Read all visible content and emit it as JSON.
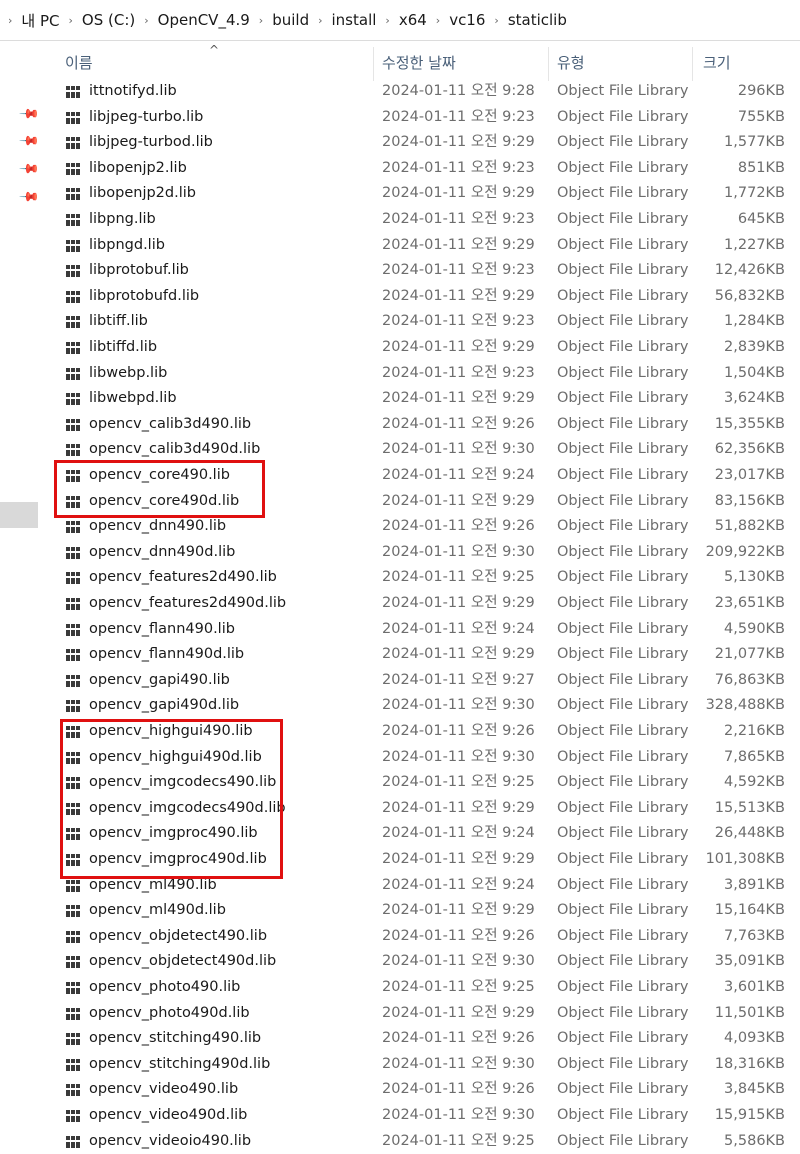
{
  "breadcrumb": [
    "내 PC",
    "OS (C:)",
    "OpenCV_4.9",
    "build",
    "install",
    "x64",
    "vc16",
    "staticlib"
  ],
  "columns": {
    "name": "이름",
    "date": "수정한 날짜",
    "type": "유형",
    "size": "크기"
  },
  "files": [
    {
      "name": "ittnotifyd.lib",
      "date": "2024-01-11 오전 9:28",
      "type": "Object File Library",
      "size": "296KB"
    },
    {
      "name": "libjpeg-turbo.lib",
      "date": "2024-01-11 오전 9:23",
      "type": "Object File Library",
      "size": "755KB"
    },
    {
      "name": "libjpeg-turbod.lib",
      "date": "2024-01-11 오전 9:29",
      "type": "Object File Library",
      "size": "1,577KB"
    },
    {
      "name": "libopenjp2.lib",
      "date": "2024-01-11 오전 9:23",
      "type": "Object File Library",
      "size": "851KB"
    },
    {
      "name": "libopenjp2d.lib",
      "date": "2024-01-11 오전 9:29",
      "type": "Object File Library",
      "size": "1,772KB"
    },
    {
      "name": "libpng.lib",
      "date": "2024-01-11 오전 9:23",
      "type": "Object File Library",
      "size": "645KB"
    },
    {
      "name": "libpngd.lib",
      "date": "2024-01-11 오전 9:29",
      "type": "Object File Library",
      "size": "1,227KB"
    },
    {
      "name": "libprotobuf.lib",
      "date": "2024-01-11 오전 9:23",
      "type": "Object File Library",
      "size": "12,426KB"
    },
    {
      "name": "libprotobufd.lib",
      "date": "2024-01-11 오전 9:29",
      "type": "Object File Library",
      "size": "56,832KB"
    },
    {
      "name": "libtiff.lib",
      "date": "2024-01-11 오전 9:23",
      "type": "Object File Library",
      "size": "1,284KB"
    },
    {
      "name": "libtiffd.lib",
      "date": "2024-01-11 오전 9:29",
      "type": "Object File Library",
      "size": "2,839KB"
    },
    {
      "name": "libwebp.lib",
      "date": "2024-01-11 오전 9:23",
      "type": "Object File Library",
      "size": "1,504KB"
    },
    {
      "name": "libwebpd.lib",
      "date": "2024-01-11 오전 9:29",
      "type": "Object File Library",
      "size": "3,624KB"
    },
    {
      "name": "opencv_calib3d490.lib",
      "date": "2024-01-11 오전 9:26",
      "type": "Object File Library",
      "size": "15,355KB"
    },
    {
      "name": "opencv_calib3d490d.lib",
      "date": "2024-01-11 오전 9:30",
      "type": "Object File Library",
      "size": "62,356KB"
    },
    {
      "name": "opencv_core490.lib",
      "date": "2024-01-11 오전 9:24",
      "type": "Object File Library",
      "size": "23,017KB"
    },
    {
      "name": "opencv_core490d.lib",
      "date": "2024-01-11 오전 9:29",
      "type": "Object File Library",
      "size": "83,156KB"
    },
    {
      "name": "opencv_dnn490.lib",
      "date": "2024-01-11 오전 9:26",
      "type": "Object File Library",
      "size": "51,882KB"
    },
    {
      "name": "opencv_dnn490d.lib",
      "date": "2024-01-11 오전 9:30",
      "type": "Object File Library",
      "size": "209,922KB"
    },
    {
      "name": "opencv_features2d490.lib",
      "date": "2024-01-11 오전 9:25",
      "type": "Object File Library",
      "size": "5,130KB"
    },
    {
      "name": "opencv_features2d490d.lib",
      "date": "2024-01-11 오전 9:29",
      "type": "Object File Library",
      "size": "23,651KB"
    },
    {
      "name": "opencv_flann490.lib",
      "date": "2024-01-11 오전 9:24",
      "type": "Object File Library",
      "size": "4,590KB"
    },
    {
      "name": "opencv_flann490d.lib",
      "date": "2024-01-11 오전 9:29",
      "type": "Object File Library",
      "size": "21,077KB"
    },
    {
      "name": "opencv_gapi490.lib",
      "date": "2024-01-11 오전 9:27",
      "type": "Object File Library",
      "size": "76,863KB"
    },
    {
      "name": "opencv_gapi490d.lib",
      "date": "2024-01-11 오전 9:30",
      "type": "Object File Library",
      "size": "328,488KB"
    },
    {
      "name": "opencv_highgui490.lib",
      "date": "2024-01-11 오전 9:26",
      "type": "Object File Library",
      "size": "2,216KB"
    },
    {
      "name": "opencv_highgui490d.lib",
      "date": "2024-01-11 오전 9:30",
      "type": "Object File Library",
      "size": "7,865KB"
    },
    {
      "name": "opencv_imgcodecs490.lib",
      "date": "2024-01-11 오전 9:25",
      "type": "Object File Library",
      "size": "4,592KB"
    },
    {
      "name": "opencv_imgcodecs490d.lib",
      "date": "2024-01-11 오전 9:29",
      "type": "Object File Library",
      "size": "15,513KB"
    },
    {
      "name": "opencv_imgproc490.lib",
      "date": "2024-01-11 오전 9:24",
      "type": "Object File Library",
      "size": "26,448KB"
    },
    {
      "name": "opencv_imgproc490d.lib",
      "date": "2024-01-11 오전 9:29",
      "type": "Object File Library",
      "size": "101,308KB"
    },
    {
      "name": "opencv_ml490.lib",
      "date": "2024-01-11 오전 9:24",
      "type": "Object File Library",
      "size": "3,891KB"
    },
    {
      "name": "opencv_ml490d.lib",
      "date": "2024-01-11 오전 9:29",
      "type": "Object File Library",
      "size": "15,164KB"
    },
    {
      "name": "opencv_objdetect490.lib",
      "date": "2024-01-11 오전 9:26",
      "type": "Object File Library",
      "size": "7,763KB"
    },
    {
      "name": "opencv_objdetect490d.lib",
      "date": "2024-01-11 오전 9:30",
      "type": "Object File Library",
      "size": "35,091KB"
    },
    {
      "name": "opencv_photo490.lib",
      "date": "2024-01-11 오전 9:25",
      "type": "Object File Library",
      "size": "3,601KB"
    },
    {
      "name": "opencv_photo490d.lib",
      "date": "2024-01-11 오전 9:29",
      "type": "Object File Library",
      "size": "11,501KB"
    },
    {
      "name": "opencv_stitching490.lib",
      "date": "2024-01-11 오전 9:26",
      "type": "Object File Library",
      "size": "4,093KB"
    },
    {
      "name": "opencv_stitching490d.lib",
      "date": "2024-01-11 오전 9:30",
      "type": "Object File Library",
      "size": "18,316KB"
    },
    {
      "name": "opencv_video490.lib",
      "date": "2024-01-11 오전 9:26",
      "type": "Object File Library",
      "size": "3,845KB"
    },
    {
      "name": "opencv_video490d.lib",
      "date": "2024-01-11 오전 9:30",
      "type": "Object File Library",
      "size": "15,915KB"
    },
    {
      "name": "opencv_videoio490.lib",
      "date": "2024-01-11 오전 9:25",
      "type": "Object File Library",
      "size": "5,586KB"
    }
  ],
  "icons": {
    "file": "library-file-icon",
    "pin": "pin-icon",
    "sort": "sort-ascending-icon",
    "breadcrumb_separator": "chevron-right-icon"
  },
  "colors": {
    "highlight_box": "#e01010",
    "header_text": "#4a6079",
    "detail_text": "#6d6d6d"
  }
}
